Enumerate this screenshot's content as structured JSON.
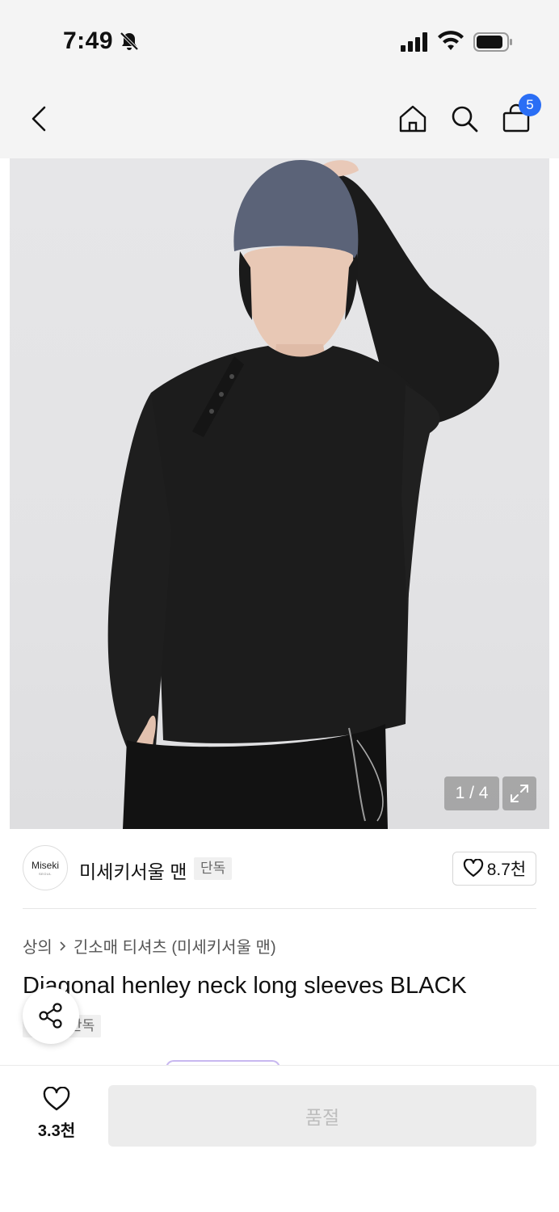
{
  "status_bar": {
    "time": "7:49",
    "icons": [
      "bell-off-icon",
      "signal-icon",
      "wifi-icon",
      "battery-icon"
    ]
  },
  "nav": {
    "icons": [
      "back-chevron-icon",
      "home-icon",
      "search-icon",
      "shopping-bag-icon"
    ],
    "cart_count": "5"
  },
  "gallery": {
    "counter": "1 / 4",
    "expand_icon": "expand-icon"
  },
  "brand": {
    "logo_text": "Miseki",
    "logo_subtext": "SEOUL",
    "name": "미세키서울 맨",
    "tag": "단독",
    "like_count": "8.7천"
  },
  "product": {
    "breadcrumb_category": "상의",
    "breadcrumb_sub": "긴소매 티셔츠 (미세키서울 맨)",
    "title": "Diagonal henley neck long sleeves BLACK",
    "tag": "단독"
  },
  "bottom_bar": {
    "wish_count": "3.3천",
    "buy_label": "품절"
  },
  "colors": {
    "accent": "#2a6ef5",
    "background": "#f4f4f4",
    "disabled_button": "#ececec"
  }
}
